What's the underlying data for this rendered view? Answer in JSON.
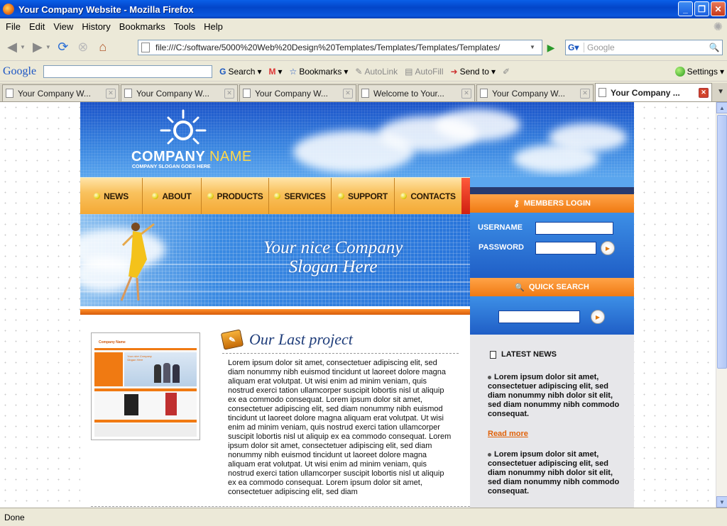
{
  "window": {
    "title": "Your Company Website - Mozilla Firefox"
  },
  "menubar": [
    "File",
    "Edit",
    "View",
    "History",
    "Bookmarks",
    "Tools",
    "Help"
  ],
  "navbar": {
    "url": "file:///C:/software/5000%20Web%20Design%20Templates/Templates/Templates/Templates/",
    "search_placeholder": "Google"
  },
  "google_toolbar": {
    "logo": "Google",
    "search_label": "Search",
    "bookmarks_label": "Bookmarks",
    "autolink_label": "AutoLink",
    "autofill_label": "AutoFill",
    "sendto_label": "Send to",
    "settings_label": "Settings"
  },
  "tabs": [
    {
      "label": "Your Company W...",
      "active": false
    },
    {
      "label": "Your Company W...",
      "active": false
    },
    {
      "label": "Your Company W...",
      "active": false
    },
    {
      "label": "Welcome to Your...",
      "active": false
    },
    {
      "label": "Your Company W...",
      "active": false
    },
    {
      "label": "Your Company ...",
      "active": true
    }
  ],
  "site": {
    "company_first": "COMPANY",
    "company_second": "NAME",
    "company_slogan": "COMPANY SLOGAN GOES HERE",
    "nav": [
      "NEWS",
      "ABOUT",
      "PRODUCTS",
      "SERVICES",
      "SUPPORT",
      "CONTACTS"
    ],
    "banner_line1": "Your nice Company",
    "banner_line2": "Slogan Here",
    "project_title": "Our Last project",
    "project_text": "Lorem ipsum dolor sit amet, consectetuer adipiscing elit, sed diam nonummy nibh euismod tincidunt ut laoreet dolore magna aliquam erat volutpat. Ut wisi enim ad minim veniam, quis nostrud exerci tation ullamcorper suscipit lobortis nisl ut aliquip ex ea commodo consequat. Lorem ipsum dolor sit amet, consectetuer adipiscing elit, sed diam nonummy nibh euismod tincidunt ut laoreet dolore magna aliquam erat volutpat. Ut wisi enim ad minim veniam, quis nostrud exerci tation ullamcorper suscipit lobortis nisl ut aliquip ex ea commodo consequat. Lorem ipsum dolor sit amet, consectetuer adipiscing elit, sed diam nonummy nibh euismod tincidunt ut laoreet dolore magna aliquam erat volutpat. Ut wisi enim ad minim veniam, quis nostrud exerci tation ullamcorper suscipit lobortis nisl ut aliquip ex ea commodo consequat. Lorem ipsum dolor sit amet, consectetuer adipiscing elit, sed diam",
    "login": {
      "title": "MEMBERS LOGIN",
      "username_label": "USERNAME",
      "password_label": "PASSWORD"
    },
    "quick_search_title": "QUICK SEARCH",
    "latest_news_title": "LATEST NEWS",
    "news1": "Lorem ipsum dolor sit amet, consectetuer adipiscing elit, sed diam nonummy nibh dolor sit elit, sed diam nonummy nibh commodo consequat.",
    "read_more": "Read more",
    "news2": "Lorem ipsum dolor sit amet, consectetuer adipiscing elit, sed diam nonummy nibh dolor sit elit, sed diam nonummy nibh commodo consequat."
  },
  "thumbnail": {
    "company_name": "Company Name",
    "slogan": "Your nice Company Slogan Here"
  },
  "status": "Done",
  "colors": {
    "accent_orange": "#f07a12",
    "site_blue": "#1f5ec6",
    "xp_title": "#0346c9"
  }
}
